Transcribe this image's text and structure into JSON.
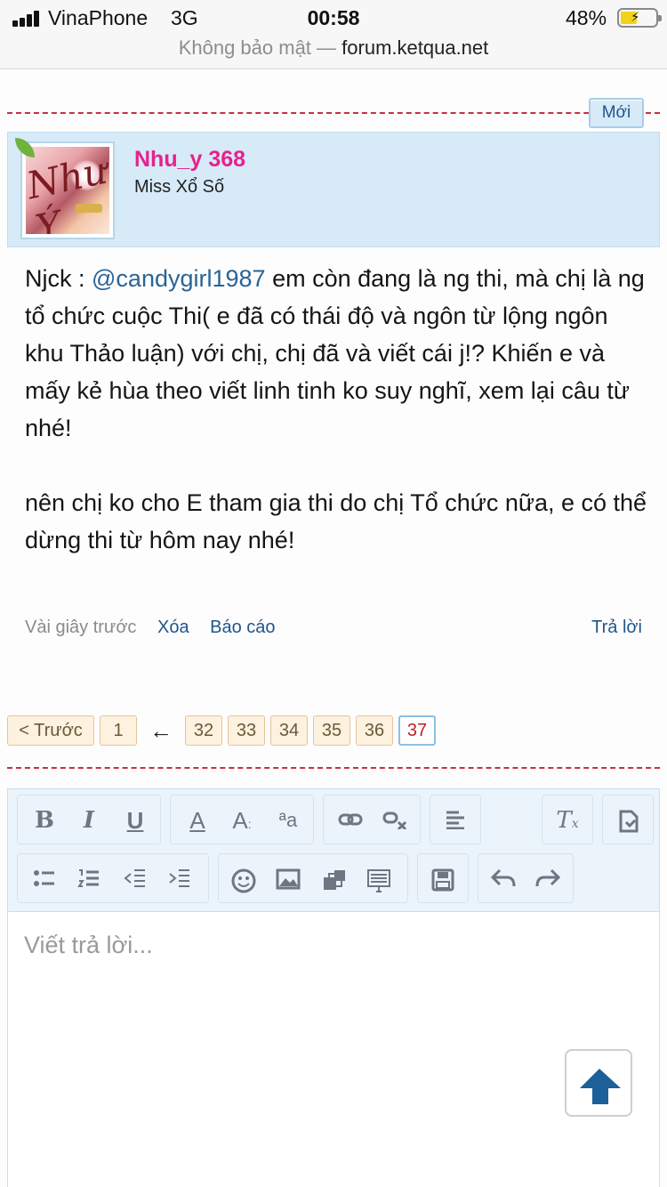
{
  "status_bar": {
    "carrier": "VinaPhone",
    "network": "3G",
    "time": "00:58",
    "battery": "48%",
    "battery_level": 0.48
  },
  "url_bar": {
    "security": "Không bảo mật —",
    "domain": "forum.ketqua.net"
  },
  "post": {
    "username": "Nhu_y 368",
    "user_title": "Miss Xổ Số",
    "badge": "Mới",
    "body_prefix": "Njck :",
    "mention": "@candygirl1987",
    "body_p1": "em còn đang là ng thi, mà chị là ng tổ chức cuộc Thi( e đã có thái độ và ngôn từ lộng ngôn khu Thảo luận) với chị, chị đã và viết cái j!? Khiến e và mấy kẻ hùa theo viết linh tinh ko suy nghĩ, xem lại câu từ nhé!",
    "body_p2": "nên chị ko cho E tham gia thi do chị Tổ chức nữa, e có thể dừng thi từ hôm nay nhé!",
    "time": "Vài giây trước",
    "delete": "Xóa",
    "report": "Báo cáo",
    "reply": "Trả lời"
  },
  "pagination": {
    "prev": "< Trước",
    "first": "1",
    "ellipsis_arrow": "←",
    "pages": [
      "32",
      "33",
      "34",
      "35",
      "36"
    ],
    "current": "37"
  },
  "editor": {
    "toolbar_icons": [
      "bold-icon",
      "italic-icon",
      "underline-icon",
      "text-color-icon",
      "font-size-icon",
      "font-family-icon",
      "link-icon",
      "unlink-icon",
      "align-icon",
      "remove-format-icon",
      "restore-draft-icon",
      "bullet-list-icon",
      "numbered-list-icon",
      "outdent-icon",
      "indent-icon",
      "smiley-icon",
      "image-icon",
      "media-icon",
      "quote-icon",
      "save-draft-icon",
      "undo-icon",
      "redo-icon"
    ],
    "placeholder": "Viết trả lời..."
  },
  "colors": {
    "username": "#e6228c",
    "link": "#23558a",
    "divider": "#c4323a",
    "post_header_bg": "#d6eaf8",
    "current_page": "#c02020"
  }
}
